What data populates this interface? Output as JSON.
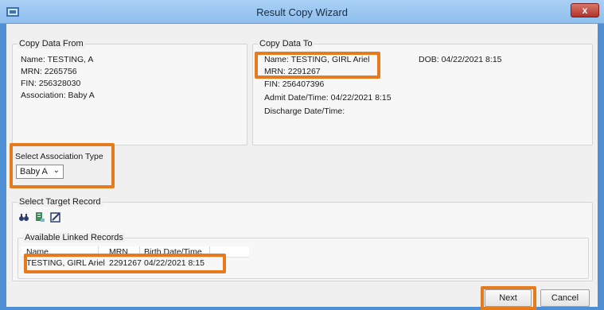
{
  "window": {
    "title": "Result Copy Wizard",
    "close_label": "x"
  },
  "copy_from": {
    "legend": "Copy Data From",
    "lines": [
      "Name: TESTING, A",
      "MRN: 2265756",
      "FIN: 256328030",
      "Association: Baby A"
    ]
  },
  "copy_to": {
    "legend": "Copy Data To",
    "name": "Name: TESTING, GIRL Ariel",
    "mrn": "MRN: 2291267",
    "dob": "DOB: 04/22/2021 8:15",
    "fin": "FIN: 256407396",
    "admit": "Admit Date/Time: 04/22/2021 8:15",
    "discharge": "Discharge Date/Time:"
  },
  "association": {
    "label": "Select Association Type",
    "selected": "Baby A"
  },
  "target": {
    "legend": "Select Target Record",
    "icons": [
      "binoculars-icon",
      "record-icon",
      "edit-icon"
    ],
    "linked": {
      "legend": "Available Linked Records",
      "columns": [
        "Name",
        "MRN",
        "Birth Date/Time"
      ],
      "rows": [
        {
          "name": "TESTING, GIRL Ariel",
          "mrn": "2291267",
          "birth": "04/22/2021 8:15"
        }
      ]
    }
  },
  "buttons": {
    "next": "Next",
    "cancel": "Cancel"
  },
  "colors": {
    "highlight": "#e57b1c",
    "titlebar": "#a9d0f5"
  }
}
